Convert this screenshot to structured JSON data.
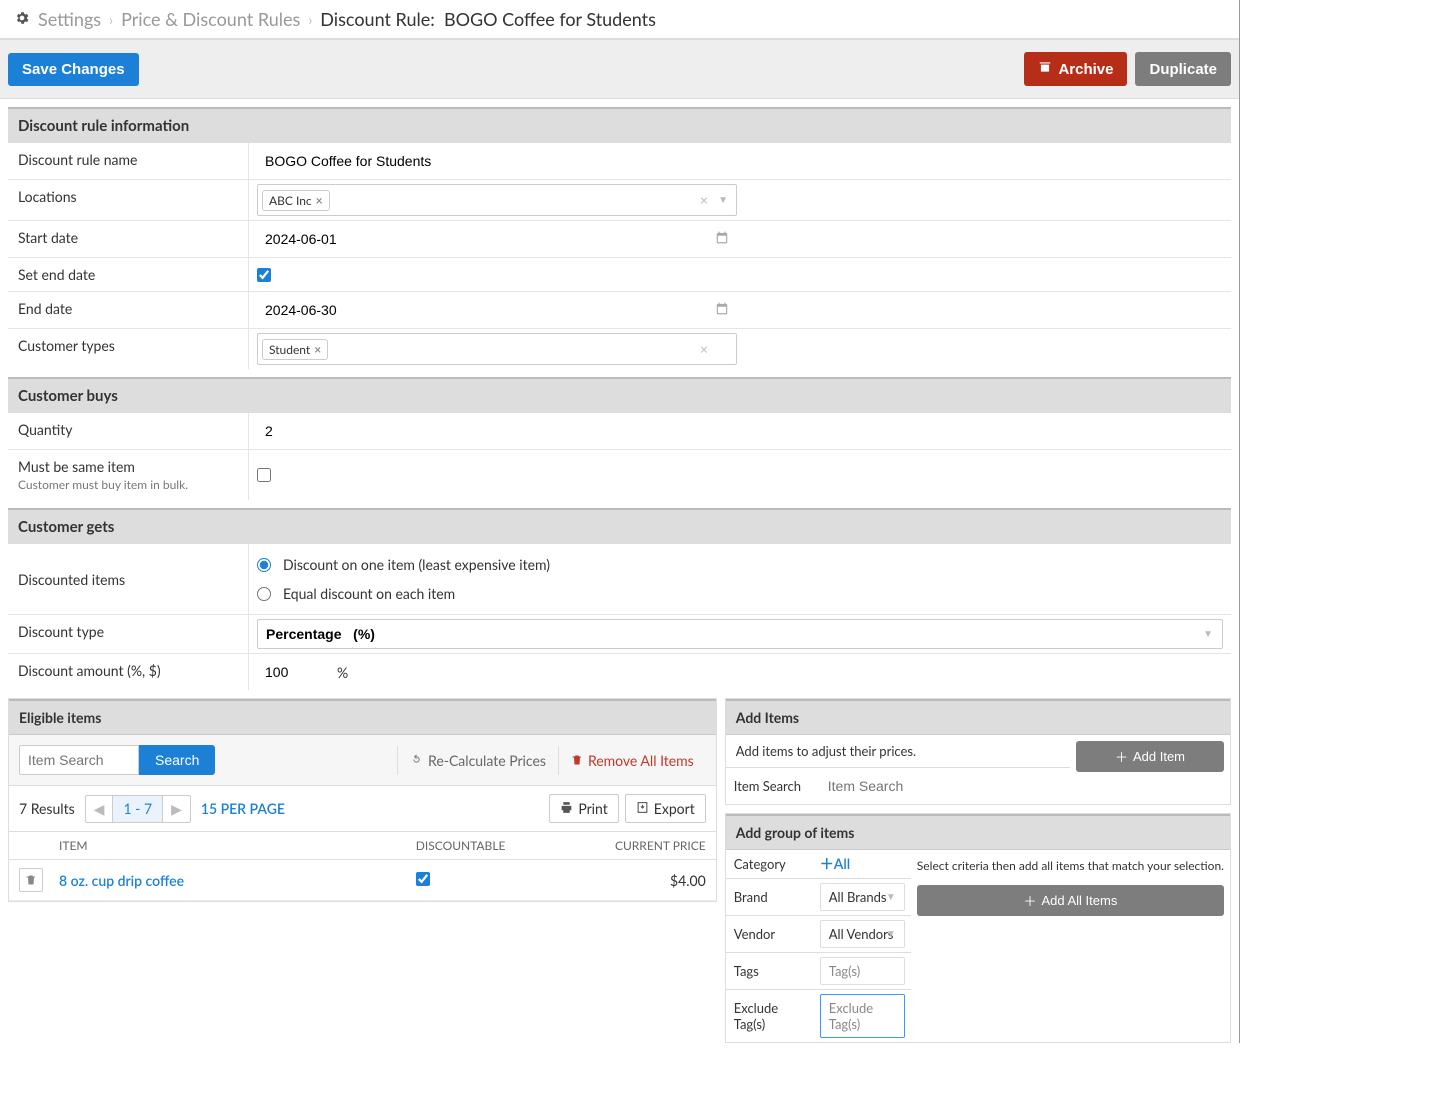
{
  "breadcrumb": {
    "level1": "Settings",
    "level2": "Price & Discount Rules",
    "level3_prefix": "Discount Rule:",
    "level3_name": "BOGO Coffee for Students"
  },
  "actions": {
    "save": "Save Changes",
    "archive": "Archive",
    "duplicate": "Duplicate"
  },
  "section_rule_info": {
    "title": "Discount rule information",
    "name_label": "Discount rule name",
    "name_value": "BOGO Coffee for Students",
    "locations_label": "Locations",
    "locations_chip": "ABC Inc",
    "start_date_label": "Start date",
    "start_date_value": "2024-06-01",
    "set_end_date_label": "Set end date",
    "set_end_date_checked": true,
    "end_date_label": "End date",
    "end_date_value": "2024-06-30",
    "customer_types_label": "Customer types",
    "customer_types_chip": "Student"
  },
  "section_buys": {
    "title": "Customer buys",
    "qty_label": "Quantity",
    "qty_value": "2",
    "same_item_label": "Must be same item",
    "same_item_sub": "Customer must buy item in bulk.",
    "same_item_checked": false
  },
  "section_gets": {
    "title": "Customer gets",
    "discounted_items_label": "Discounted items",
    "radio_one": "Discount on one item (least expensive item)",
    "radio_each": "Equal discount on each item",
    "radio_selected": "one",
    "discount_type_label": "Discount type",
    "discount_type_value": "Percentage   (%)",
    "discount_amount_label": "Discount amount (%, $)",
    "discount_amount_value": "100",
    "discount_amount_suffix": "%"
  },
  "eligible": {
    "title": "Eligible items",
    "search_placeholder": "Item Search",
    "search_btn": "Search",
    "recalc": "Re-Calculate Prices",
    "remove_all": "Remove All Items",
    "results_text": "7 Results",
    "pager_current": "1 - 7",
    "per_page": "15 PER PAGE",
    "print": "Print",
    "export": "Export",
    "cols": {
      "item": "ITEM",
      "discountable": "DISCOUNTABLE",
      "price": "CURRENT PRICE"
    },
    "rows": [
      {
        "name": "8 oz. cup drip coffee",
        "discountable": true,
        "price": "$4.00"
      }
    ]
  },
  "add_items": {
    "title": "Add Items",
    "instr": "Add items to adjust their prices.",
    "item_search_label": "Item Search",
    "item_search_placeholder": "Item Search",
    "add_item_btn": "Add Item"
  },
  "add_group": {
    "title": "Add group of items",
    "side_instr": "Select criteria then add all items that match your selection.",
    "add_all_btn": "Add All Items",
    "category_label": "Category",
    "category_all": "All",
    "brand_label": "Brand",
    "brand_value": "All Brands",
    "vendor_label": "Vendor",
    "vendor_value": "All Vendors",
    "tags_label": "Tags",
    "tags_placeholder": "Tag(s)",
    "exclude_label": "Exclude Tag(s)",
    "exclude_placeholder": "Exclude Tag(s)"
  }
}
